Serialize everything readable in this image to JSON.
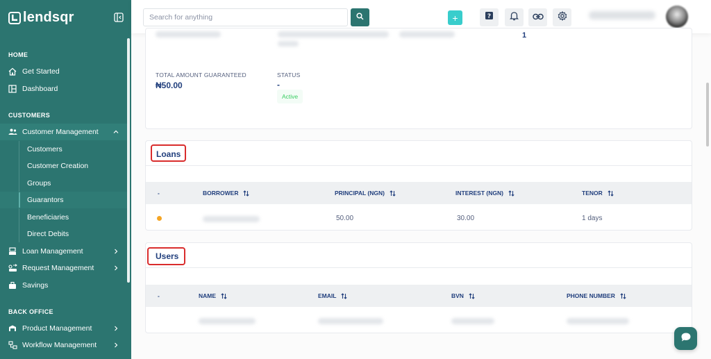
{
  "brand": {
    "name": "lendsqr",
    "primary_color": "#2c7570",
    "accent_color": "#39cdcc"
  },
  "sidebar": {
    "sections": [
      {
        "label": "HOME"
      },
      {
        "label": "CUSTOMERS"
      },
      {
        "label": "BACK OFFICE"
      }
    ],
    "home_items": [
      {
        "label": "Get Started",
        "icon": "home-icon"
      },
      {
        "label": "Dashboard",
        "icon": "dashboard-icon"
      }
    ],
    "customer_management": {
      "label": "Customer Management",
      "icon": "users-icon",
      "expanded": true,
      "children": [
        {
          "label": "Customers"
        },
        {
          "label": "Customer Creation"
        },
        {
          "label": "Groups"
        },
        {
          "label": "Guarantors",
          "active": true
        },
        {
          "label": "Beneficiaries"
        },
        {
          "label": "Direct Debits"
        }
      ]
    },
    "other_customer_items": [
      {
        "label": "Loan Management",
        "icon": "loan-icon"
      },
      {
        "label": "Request Management",
        "icon": "request-icon"
      },
      {
        "label": "Savings",
        "icon": "savings-icon"
      }
    ],
    "back_office_items": [
      {
        "label": "Product Management",
        "icon": "product-icon"
      },
      {
        "label": "Workflow Management",
        "icon": "workflow-icon"
      }
    ]
  },
  "topbar": {
    "search_placeholder": "Search for anything",
    "add_label": "+",
    "icons": [
      "help-icon",
      "bell-icon",
      "link-icon",
      "settings-icon"
    ]
  },
  "summary": {
    "total_guaranteed_label": "TOTAL AMOUNT GUARANTEED",
    "total_guaranteed_value": "₦50.00",
    "status_label": "STATUS",
    "status_value": "-",
    "status_badge": "Active",
    "count_value": "1"
  },
  "loans": {
    "title": "Loans",
    "columns": [
      "-",
      "BORROWER",
      "PRINCIPAL (NGN)",
      "INTEREST (NGN)",
      "TENOR"
    ],
    "rows": [
      {
        "principal": "50.00",
        "interest": "30.00",
        "tenor": "1 days"
      }
    ]
  },
  "users": {
    "title": "Users",
    "columns": [
      "-",
      "NAME",
      "EMAIL",
      "BVN",
      "PHONE NUMBER"
    ]
  }
}
